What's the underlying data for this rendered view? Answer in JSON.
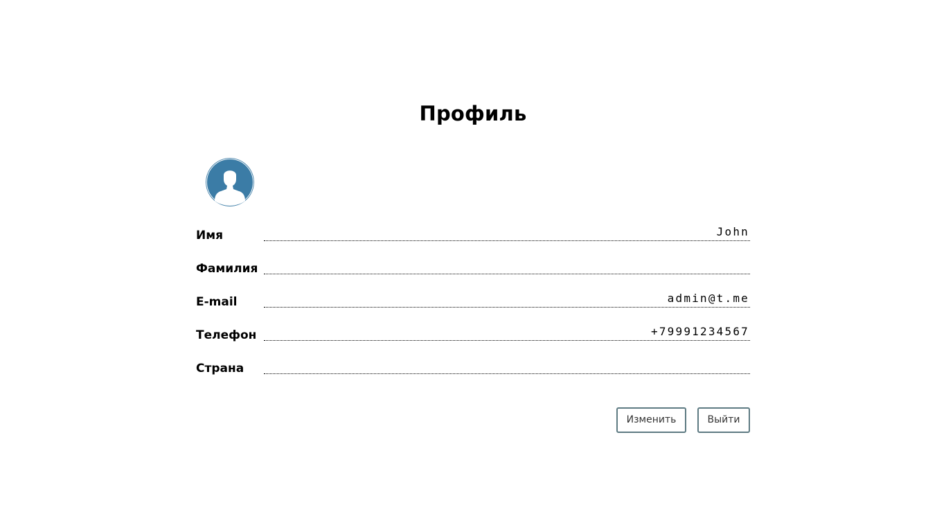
{
  "page": {
    "title": "Профиль"
  },
  "avatar": {
    "icon": "user-avatar-icon",
    "color": "#3b7ca6"
  },
  "fields": [
    {
      "label": "Имя",
      "value": "John"
    },
    {
      "label": "Фамилия",
      "value": ""
    },
    {
      "label": "E-mail",
      "value": "admin@t.me"
    },
    {
      "label": "Телефон",
      "value": "+79991234567"
    },
    {
      "label": "Страна",
      "value": ""
    }
  ],
  "actions": {
    "edit_label": "Изменить",
    "exit_label": "Выйти",
    "border_color": "#5d7a82"
  }
}
